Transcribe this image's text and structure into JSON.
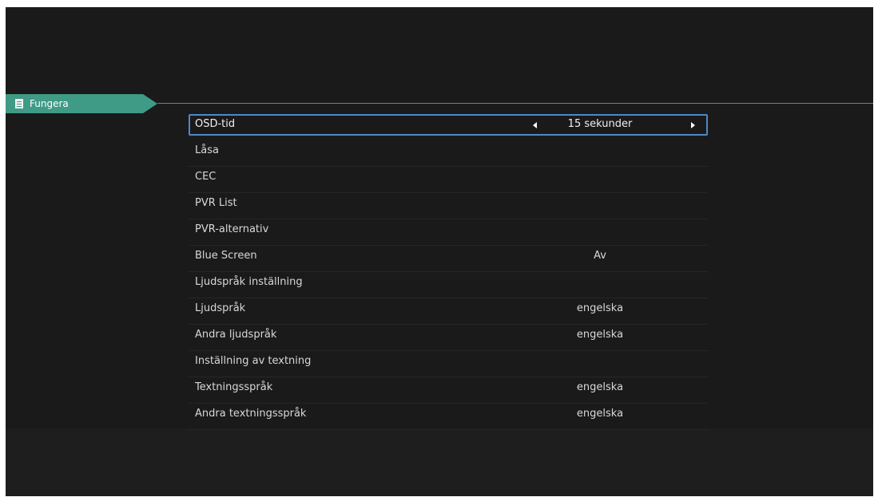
{
  "tab": {
    "label": "Fungera",
    "icon": "document-list-icon",
    "accent_color": "#3f9a86"
  },
  "selection_color": "#4f87c6",
  "menu": {
    "items": [
      {
        "label": "OSD-tid",
        "value": "15 sekunder",
        "selected": true
      },
      {
        "label": "Låsa",
        "value": ""
      },
      {
        "label": "CEC",
        "value": ""
      },
      {
        "label": "PVR List",
        "value": ""
      },
      {
        "label": "PVR-alternativ",
        "value": ""
      },
      {
        "label": "Blue Screen",
        "value": "Av"
      },
      {
        "label": "Ljudspråk inställning",
        "value": ""
      },
      {
        "label": "Ljudspråk",
        "value": "engelska"
      },
      {
        "label": "Andra ljudspråk",
        "value": "engelska"
      },
      {
        "label": "Inställning av textning",
        "value": ""
      },
      {
        "label": "Textningsspråk",
        "value": "engelska"
      },
      {
        "label": "Andra textningsspråk",
        "value": "engelska"
      }
    ]
  }
}
